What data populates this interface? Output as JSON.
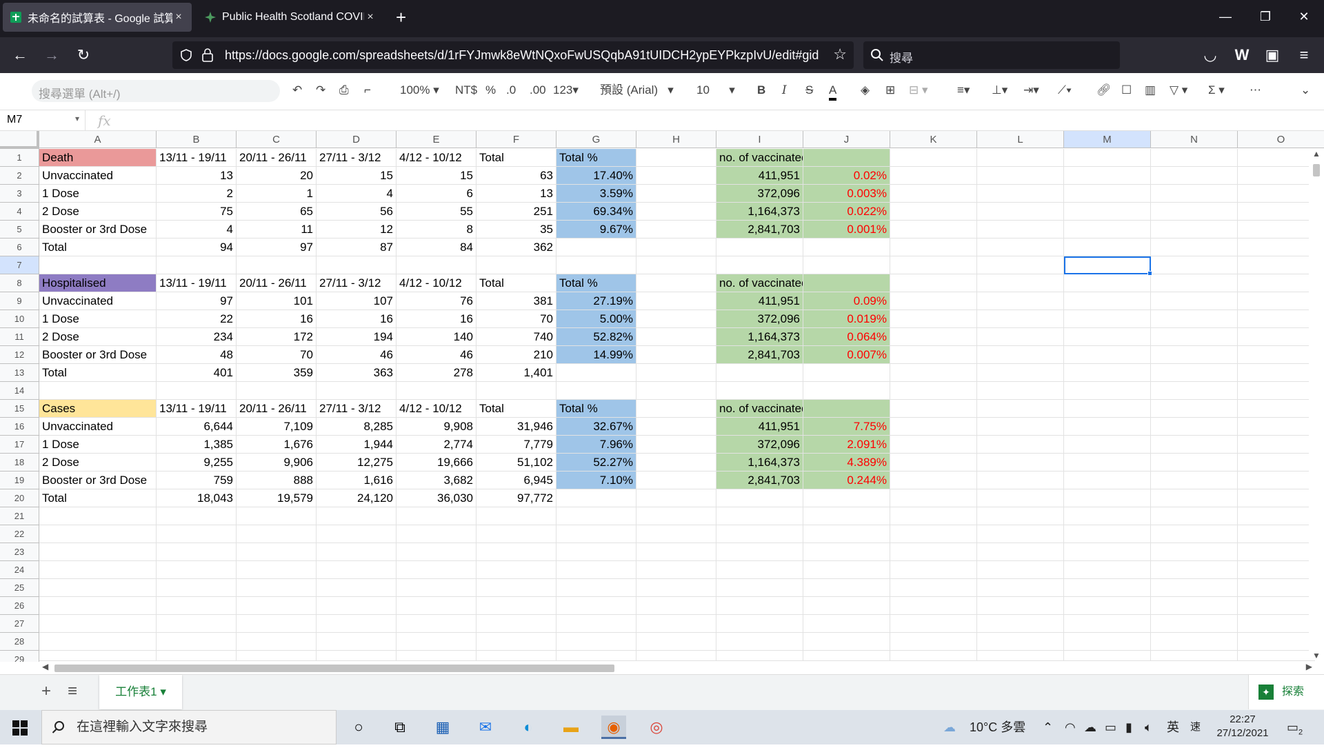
{
  "browser": {
    "tabs": [
      {
        "title": "未命名的試算表 - Google 試算表",
        "close": "×"
      },
      {
        "title": "Public Health Scotland COVID",
        "close": "×"
      }
    ],
    "new_tab": "+",
    "url": "https://docs.google.com/spreadsheets/d/1rFYJmwk8eWtNQxoFwUSQqbA91tUIDCH2ypEYPkzpIvU/edit#gid",
    "search_placeholder": "搜尋"
  },
  "toolbar": {
    "menu_search": "搜尋選單 (Alt+/)",
    "zoom": "100%",
    "currency": "NT$",
    "percent": "%",
    "decrease_decimal": ".0",
    "increase_decimal": ".00",
    "more_formats": "123",
    "font": "預設 (Arial)",
    "font_size": "10",
    "bold": "B",
    "italic": "I",
    "strike": "S",
    "text_color": "A"
  },
  "formula_bar": {
    "name_box": "M7",
    "fx": "fx",
    "value": ""
  },
  "grid": {
    "columns": [
      "A",
      "B",
      "C",
      "D",
      "E",
      "F",
      "G",
      "H",
      "I",
      "J",
      "K",
      "L",
      "M",
      "N",
      "O"
    ],
    "rows": [
      "1",
      "2",
      "3",
      "4",
      "5",
      "6",
      "7",
      "8",
      "9",
      "10",
      "11",
      "12",
      "13",
      "14",
      "15",
      "16",
      "17",
      "18",
      "19",
      "20",
      "21",
      "22",
      "23",
      "24",
      "25",
      "26",
      "27",
      "28",
      "29"
    ],
    "cells": [
      [
        "Death",
        "13/11 - 19/11",
        "20/11 - 26/11",
        "27/11 - 3/12",
        "4/12 - 10/12",
        "Total",
        "Total %",
        "",
        "no. of vaccinated",
        ""
      ],
      [
        "Unvaccinated",
        "13",
        "20",
        "15",
        "15",
        "63",
        "17.40%",
        "",
        "411,951",
        "0.02%"
      ],
      [
        "1 Dose",
        "2",
        "1",
        "4",
        "6",
        "13",
        "3.59%",
        "",
        "372,096",
        "0.003%"
      ],
      [
        "2 Dose",
        "75",
        "65",
        "56",
        "55",
        "251",
        "69.34%",
        "",
        "1,164,373",
        "0.022%"
      ],
      [
        "Booster or 3rd Dose",
        "4",
        "11",
        "12",
        "8",
        "35",
        "9.67%",
        "",
        "2,841,703",
        "0.001%"
      ],
      [
        "Total",
        "94",
        "97",
        "87",
        "84",
        "362",
        "",
        "",
        "",
        ""
      ],
      [
        "",
        "",
        "",
        "",
        "",
        "",
        "",
        "",
        "",
        ""
      ],
      [
        "Hospitalised",
        "13/11 - 19/11",
        "20/11 - 26/11",
        "27/11 - 3/12",
        "4/12 - 10/12",
        "Total",
        "Total %",
        "",
        "no. of vaccinated",
        ""
      ],
      [
        "Unvaccinated",
        "97",
        "101",
        "107",
        "76",
        "381",
        "27.19%",
        "",
        "411,951",
        "0.09%"
      ],
      [
        "1 Dose",
        "22",
        "16",
        "16",
        "16",
        "70",
        "5.00%",
        "",
        "372,096",
        "0.019%"
      ],
      [
        "2 Dose",
        "234",
        "172",
        "194",
        "140",
        "740",
        "52.82%",
        "",
        "1,164,373",
        "0.064%"
      ],
      [
        "Booster or 3rd Dose",
        "48",
        "70",
        "46",
        "46",
        "210",
        "14.99%",
        "",
        "2,841,703",
        "0.007%"
      ],
      [
        "Total",
        "401",
        "359",
        "363",
        "278",
        "1,401",
        "",
        "",
        "",
        ""
      ],
      [
        "",
        "",
        "",
        "",
        "",
        "",
        "",
        "",
        "",
        ""
      ],
      [
        "Cases",
        "13/11 - 19/11",
        "20/11 - 26/11",
        "27/11 - 3/12",
        "4/12 - 10/12",
        "Total",
        "Total %",
        "",
        "no. of vaccinated",
        ""
      ],
      [
        "Unvaccinated",
        "6,644",
        "7,109",
        "8,285",
        "9,908",
        "31,946",
        "32.67%",
        "",
        "411,951",
        "7.75%"
      ],
      [
        "1 Dose",
        "1,385",
        "1,676",
        "1,944",
        "2,774",
        "7,779",
        "7.96%",
        "",
        "372,096",
        "2.091%"
      ],
      [
        "2 Dose",
        "9,255",
        "9,906",
        "12,275",
        "19,666",
        "51,102",
        "52.27%",
        "",
        "1,164,373",
        "4.389%"
      ],
      [
        "Booster or 3rd Dose",
        "759",
        "888",
        "1,616",
        "3,682",
        "6,945",
        "7.10%",
        "",
        "2,841,703",
        "0.244%"
      ],
      [
        "Total",
        "18,043",
        "19,579",
        "24,120",
        "36,030",
        "97,772",
        "",
        "",
        "",
        ""
      ]
    ],
    "colors": {
      "death": "#ea9999",
      "hospitalised": "#8e7cc3",
      "cases": "#ffe599",
      "total_pct": "#9fc5e8",
      "vaccinated": "#b6d7a8",
      "rate_text": "#ff0000"
    }
  },
  "sheets": {
    "add": "+",
    "list": "≡",
    "active": "工作表1",
    "explore": "探索"
  },
  "taskbar": {
    "search_placeholder": "在這裡輸入文字來搜尋",
    "weather": "10°C 多雲",
    "ime": "英",
    "ime2": "速",
    "time": "22:27",
    "date": "27/12/2021",
    "notif_count": "2"
  }
}
